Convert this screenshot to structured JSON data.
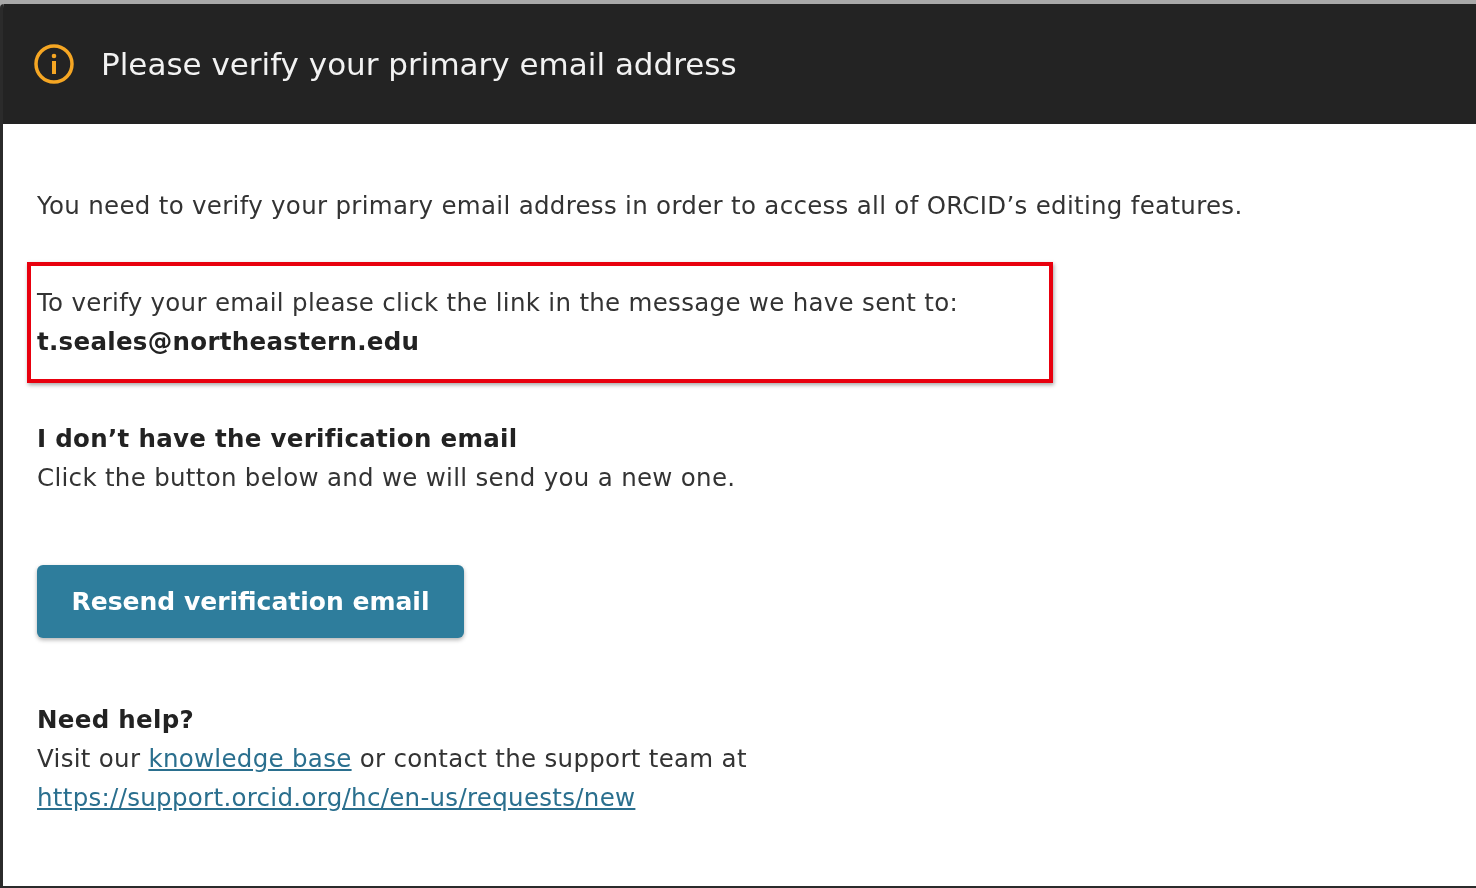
{
  "dialog": {
    "title": "Please verify your primary email address",
    "intro": "You need to verify your primary email address in order to access all of ORCID’s editing features.",
    "highlight": {
      "text": "To verify your email please click the link in the message we have sent to:",
      "email": "t.seales@northeastern.edu"
    },
    "missing": {
      "heading": "I don’t have the verification email",
      "text": "Click the button below and we will send you a new one."
    },
    "button": "Resend verification email",
    "help": {
      "heading": "Need help?",
      "text_before": "Visit our",
      "link": "knowledge base",
      "text_after": "or contact the support team at",
      "url": "https://support.orcid.org/hc/en-us/requests/new"
    }
  }
}
